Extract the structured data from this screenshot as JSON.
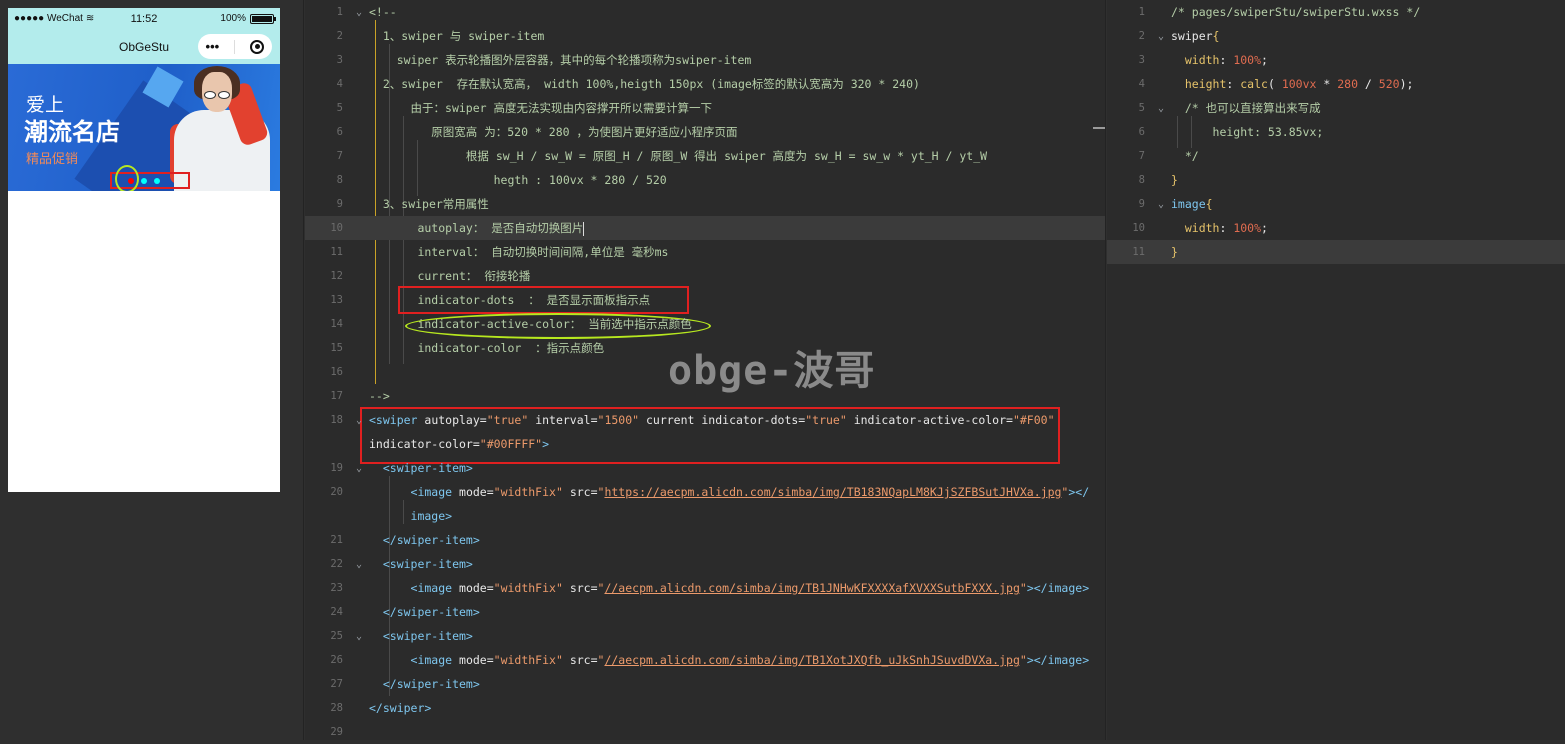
{
  "simulator": {
    "carrier": "●●●●● WeChat",
    "time": "11:52",
    "battery": "100%",
    "battery_level": 1.0,
    "page_title": "ObGeStu",
    "more_label": "•••",
    "banner": {
      "line1": "爱上",
      "line2": "潮流名店",
      "line3": "精品促销"
    },
    "indicator_active_color": "#ff0000",
    "indicator_color": "#00ffff"
  },
  "wxml": {
    "lines": [
      {
        "n": "1",
        "fold": "⌄",
        "segs": [
          [
            "c-comment",
            "<!--"
          ]
        ]
      },
      {
        "n": "2",
        "fold": "",
        "segs": [
          [
            "c-comment",
            "  1、swiper 与 swiper-item"
          ]
        ]
      },
      {
        "n": "3",
        "fold": "",
        "segs": [
          [
            "c-comment",
            "    swiper 表示轮播图外层容器，其中的每个轮播项称为swiper-item"
          ]
        ]
      },
      {
        "n": "4",
        "fold": "",
        "segs": [
          [
            "c-comment",
            "  2、swiper  存在默认宽高， width 100%,heigth 150px (image标签的默认宽高为 320 * 240)"
          ]
        ]
      },
      {
        "n": "5",
        "fold": "",
        "segs": [
          [
            "c-comment",
            "      由于：swiper 高度无法实现由内容撑开所以需要计算一下"
          ]
        ]
      },
      {
        "n": "6",
        "fold": "",
        "segs": [
          [
            "c-comment",
            "         原图宽高 为：520 * 280 ，为使图片更好适应小程序页面"
          ]
        ]
      },
      {
        "n": "7",
        "fold": "",
        "segs": [
          [
            "c-comment",
            "              根据 sw_H / sw_W = 原图_H / 原图_W 得出 swiper 高度为 sw_H = sw_w * yt_H / yt_W"
          ]
        ]
      },
      {
        "n": "8",
        "fold": "",
        "segs": [
          [
            "c-comment",
            "                  hegth : 100vx * 280 / 520"
          ]
        ]
      },
      {
        "n": "9",
        "fold": "",
        "segs": [
          [
            "c-comment",
            "  3、swiper常用属性"
          ]
        ]
      },
      {
        "n": "10",
        "fold": "",
        "segs": [
          [
            "c-comment",
            "       autoplay： 是否自动切换图片"
          ]
        ],
        "hl": true
      },
      {
        "n": "11",
        "fold": "",
        "segs": [
          [
            "c-comment",
            "       interval： 自动切换时间间隔,单位是 毫秒ms"
          ]
        ]
      },
      {
        "n": "12",
        "fold": "",
        "segs": [
          [
            "c-comment",
            "       current： 衔接轮播"
          ]
        ]
      },
      {
        "n": "13",
        "fold": "",
        "segs": [
          [
            "c-comment",
            "       indicator-dots  ： 是否显示面板指示点"
          ]
        ]
      },
      {
        "n": "14",
        "fold": "",
        "segs": [
          [
            "c-comment",
            "       indicator-active-color： 当前选中指示点颜色"
          ]
        ]
      },
      {
        "n": "15",
        "fold": "",
        "segs": [
          [
            "c-comment",
            "       indicator-color  ：指示点颜色"
          ]
        ]
      },
      {
        "n": "16",
        "fold": "",
        "segs": [
          [
            "c-comment",
            ""
          ]
        ]
      },
      {
        "n": "17",
        "fold": "",
        "segs": [
          [
            "c-comment",
            "-->"
          ]
        ]
      },
      {
        "n": "18",
        "fold": "⌄",
        "segs": [
          [
            "c-tag",
            "<swiper"
          ],
          [
            "c-attr",
            " autoplay="
          ],
          [
            "c-str",
            "\"true\""
          ],
          [
            "c-attr",
            " interval="
          ],
          [
            "c-str",
            "\"1500\""
          ],
          [
            "c-attr",
            " current indicator-dots="
          ],
          [
            "c-str",
            "\"true\""
          ],
          [
            "c-attr",
            " indicator-active-color="
          ],
          [
            "c-str",
            "\"#F00\""
          ]
        ]
      },
      {
        "n": "",
        "fold": "",
        "segs": [
          [
            "c-attr",
            "indicator-color="
          ],
          [
            "c-str",
            "\"#00FFFF\""
          ],
          [
            "c-tag",
            ">"
          ]
        ]
      },
      {
        "n": "19",
        "fold": "⌄",
        "segs": [
          [
            "c-tag",
            "  <swiper-item>"
          ]
        ]
      },
      {
        "n": "20",
        "fold": "",
        "segs": [
          [
            "c-tag",
            "      <image"
          ],
          [
            "c-attr",
            " mode="
          ],
          [
            "c-str",
            "\"widthFix\""
          ],
          [
            "c-attr",
            " src="
          ],
          [
            "c-str",
            "\""
          ],
          [
            "c-url",
            "https://aecpm.alicdn.com/simba/img/TB183NQapLM8KJjSZFBSutJHVXa.jpg"
          ],
          [
            "c-str",
            "\""
          ],
          [
            "c-tag",
            "></"
          ]
        ]
      },
      {
        "n": "",
        "fold": "",
        "segs": [
          [
            "c-tag",
            "      image>"
          ]
        ]
      },
      {
        "n": "21",
        "fold": "",
        "segs": [
          [
            "c-tag",
            "  </swiper-item>"
          ]
        ]
      },
      {
        "n": "22",
        "fold": "⌄",
        "segs": [
          [
            "c-tag",
            "  <swiper-item>"
          ]
        ]
      },
      {
        "n": "23",
        "fold": "",
        "segs": [
          [
            "c-tag",
            "      <image"
          ],
          [
            "c-attr",
            " mode="
          ],
          [
            "c-str",
            "\"widthFix\""
          ],
          [
            "c-attr",
            " src="
          ],
          [
            "c-str",
            "\""
          ],
          [
            "c-url",
            "//aecpm.alicdn.com/simba/img/TB1JNHwKFXXXXafXVXXSutbFXXX.jpg"
          ],
          [
            "c-str",
            "\""
          ],
          [
            "c-tag",
            "></image>"
          ]
        ]
      },
      {
        "n": "24",
        "fold": "",
        "segs": [
          [
            "c-tag",
            "  </swiper-item>"
          ]
        ]
      },
      {
        "n": "25",
        "fold": "⌄",
        "segs": [
          [
            "c-tag",
            "  <swiper-item>"
          ]
        ]
      },
      {
        "n": "26",
        "fold": "",
        "segs": [
          [
            "c-tag",
            "      <image"
          ],
          [
            "c-attr",
            " mode="
          ],
          [
            "c-str",
            "\"widthFix\""
          ],
          [
            "c-attr",
            " src="
          ],
          [
            "c-str",
            "\""
          ],
          [
            "c-url",
            "//aecpm.alicdn.com/simba/img/TB1XotJXQfb_uJkSnhJSuvdDVXa.jpg"
          ],
          [
            "c-str",
            "\""
          ],
          [
            "c-tag",
            "></image>"
          ]
        ]
      },
      {
        "n": "27",
        "fold": "",
        "segs": [
          [
            "c-tag",
            "  </swiper-item>"
          ]
        ]
      },
      {
        "n": "28",
        "fold": "",
        "segs": [
          [
            "c-tag",
            "</swiper>"
          ]
        ]
      },
      {
        "n": "29",
        "fold": "",
        "segs": [
          [
            "c-attr",
            ""
          ]
        ]
      }
    ],
    "watermark": "obge-波哥"
  },
  "wxss": {
    "lines": [
      {
        "n": "1",
        "fold": "",
        "segs": [
          [
            "c-comment",
            "/* pages/swiperStu/swiperStu.wxss */"
          ]
        ]
      },
      {
        "n": "2",
        "fold": "⌄",
        "segs": [
          [
            "c-sel",
            "swiper"
          ],
          [
            "c-brace",
            "{"
          ]
        ]
      },
      {
        "n": "3",
        "fold": "",
        "segs": [
          [
            "c-prop",
            "  width"
          ],
          [
            "c-attr",
            ": "
          ],
          [
            "c-num",
            "100%"
          ],
          [
            "c-attr",
            ";"
          ]
        ]
      },
      {
        "n": "4",
        "fold": "",
        "segs": [
          [
            "c-prop",
            "  height"
          ],
          [
            "c-attr",
            ": "
          ],
          [
            "c-fn",
            "calc"
          ],
          [
            "c-attr",
            "( "
          ],
          [
            "c-num",
            "100vx"
          ],
          [
            "c-attr",
            " * "
          ],
          [
            "c-num",
            "280"
          ],
          [
            "c-attr",
            " / "
          ],
          [
            "c-num",
            "520"
          ],
          [
            "c-attr",
            ");"
          ]
        ]
      },
      {
        "n": "5",
        "fold": "⌄",
        "segs": [
          [
            "c-comment",
            "  /* 也可以直接算出来写成"
          ]
        ]
      },
      {
        "n": "6",
        "fold": "",
        "segs": [
          [
            "c-comment",
            "      height: 53.85vx;"
          ]
        ]
      },
      {
        "n": "7",
        "fold": "",
        "segs": [
          [
            "c-comment",
            "  */"
          ]
        ]
      },
      {
        "n": "8",
        "fold": "",
        "segs": [
          [
            "c-brace",
            "}"
          ]
        ]
      },
      {
        "n": "9",
        "fold": "⌄",
        "segs": [
          [
            "c-tag",
            "image"
          ],
          [
            "c-brace",
            "{"
          ]
        ]
      },
      {
        "n": "10",
        "fold": "",
        "segs": [
          [
            "c-prop",
            "  width"
          ],
          [
            "c-attr",
            ": "
          ],
          [
            "c-num",
            "100%"
          ],
          [
            "c-attr",
            ";"
          ]
        ]
      },
      {
        "n": "11",
        "fold": "",
        "segs": [
          [
            "c-brace",
            "}"
          ]
        ],
        "hl": true
      }
    ]
  }
}
